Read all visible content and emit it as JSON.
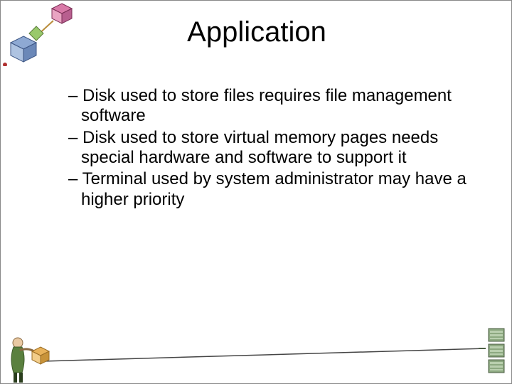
{
  "title": "Application",
  "bullets": [
    "Disk used to store files requires file management software",
    "Disk used to store virtual memory pages needs special hardware and software to support it",
    "Terminal used by system administrator may have a higher priority"
  ],
  "bullet_prefix": "– "
}
